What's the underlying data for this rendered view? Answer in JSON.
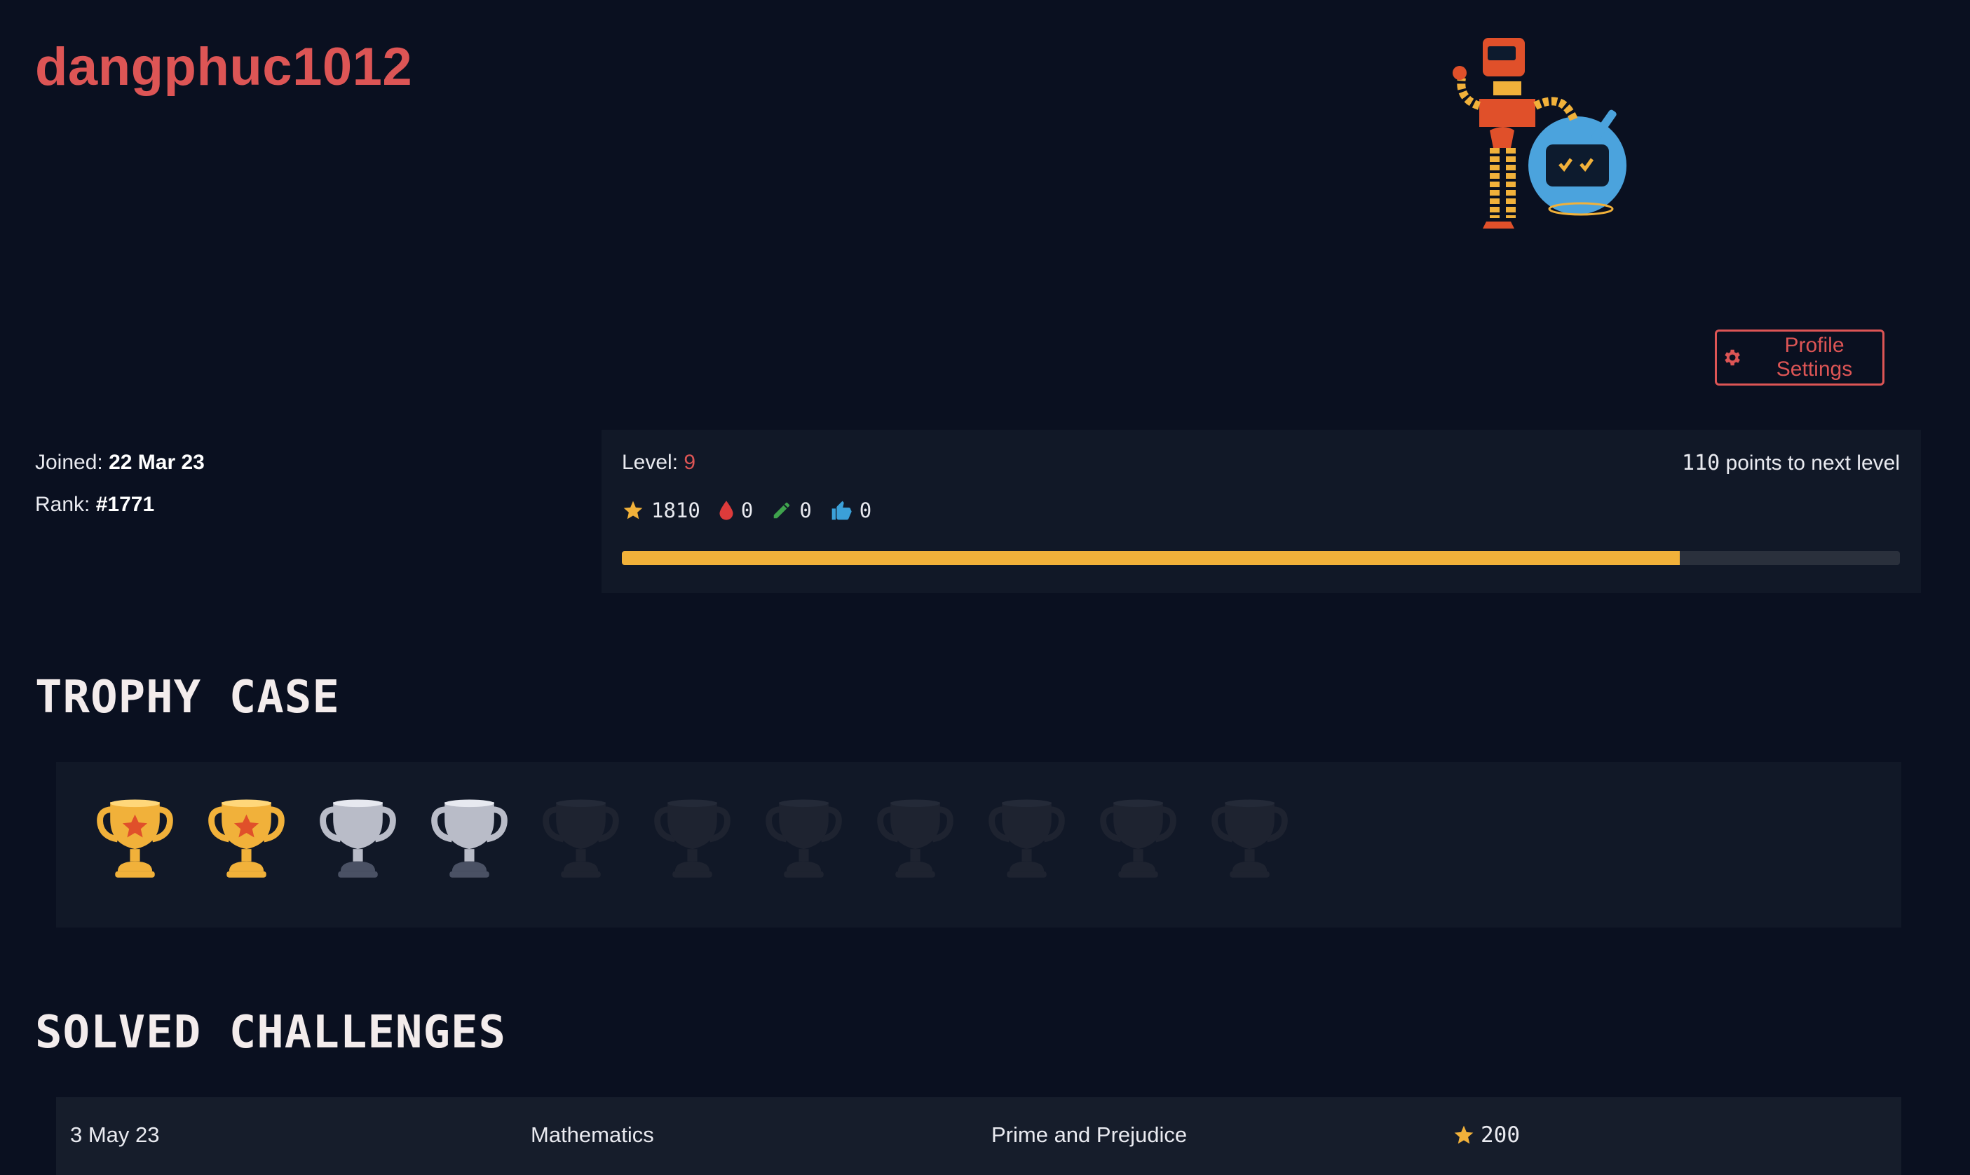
{
  "profile": {
    "username": "dangphuc1012",
    "joined_label": "Joined:",
    "joined_value": "22 Mar 23",
    "rank_label": "Rank:",
    "rank_value": "#1771",
    "settings_label": "Profile Settings"
  },
  "level": {
    "label": "Level:",
    "value": "9",
    "next_level_points": "110",
    "next_level_text": "points to next level",
    "progress_fraction": 0.828
  },
  "stats": {
    "points": "1810",
    "first_bloods": "0",
    "write_ups": "0",
    "likes": "0",
    "icons": [
      "star-icon",
      "blood-drop-icon",
      "pencil-icon",
      "thumbs-up-icon"
    ]
  },
  "sections": {
    "trophy_case": "TROPHY CASE",
    "solved_challenges": "SOLVED CHALLENGES"
  },
  "trophies": [
    "gold",
    "gold",
    "silver",
    "silver",
    "locked",
    "locked",
    "locked",
    "locked",
    "locked",
    "locked",
    "locked"
  ],
  "solved": [
    {
      "date": "3 May 23",
      "category": "Mathematics",
      "name": "Prime and Prejudice",
      "points": "200"
    }
  ],
  "colors": {
    "background": "#0a1020",
    "panel": "#111827",
    "accent": "#dd5555",
    "gold": "#f1b13a",
    "silver": "#b9bcc8",
    "locked": "#1e2330"
  }
}
